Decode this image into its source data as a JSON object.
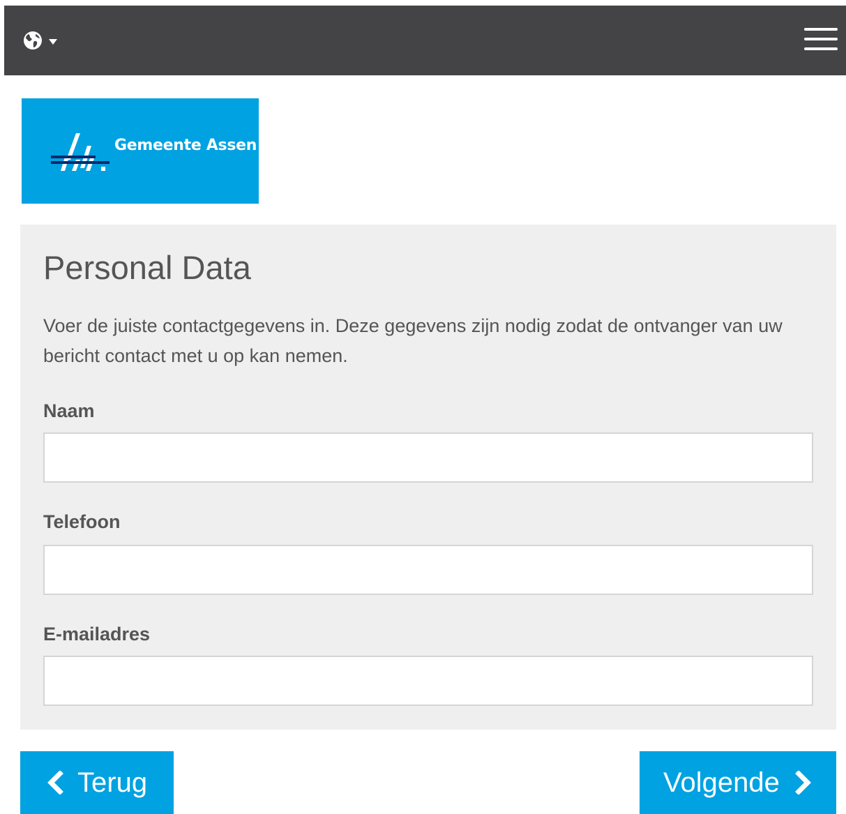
{
  "header": {
    "language_icon": "globe-icon",
    "language_caret_icon": "caret-down-icon",
    "menu_icon": "hamburger-menu-icon",
    "background_color": "#444446"
  },
  "logo": {
    "text": "Gemeente Assen",
    "background_color": "#00a2e1"
  },
  "form": {
    "title": "Personal Data",
    "intro": "Voer de juiste contactgegevens in. Deze gegevens zijn nodig zodat de ontvanger van uw bericht contact met u op kan nemen.",
    "fields": [
      {
        "label": "Naam",
        "value": ""
      },
      {
        "label": "Telefoon",
        "value": ""
      },
      {
        "label": "E-mailadres",
        "value": ""
      }
    ]
  },
  "navigation": {
    "back_label": "Terug",
    "back_icon": "chevron-left-icon",
    "next_label": "Volgende",
    "next_icon": "chevron-right-icon",
    "button_color": "#00a2e1"
  }
}
